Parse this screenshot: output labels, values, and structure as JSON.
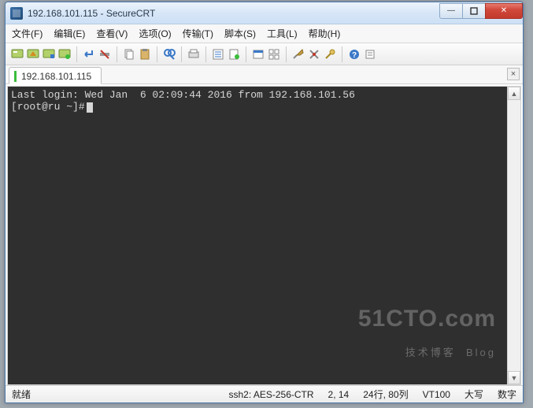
{
  "titlebar": {
    "title": "192.168.101.115 - SecureCRT"
  },
  "menu": {
    "file": "文件(F)",
    "edit": "编辑(E)",
    "view": "查看(V)",
    "options": "选项(O)",
    "transfer": "传输(T)",
    "script": "脚本(S)",
    "tools": "工具(L)",
    "help": "帮助(H)"
  },
  "tab": {
    "label": "192.168.101.115"
  },
  "terminal": {
    "line1": "Last login: Wed Jan  6 02:09:44 2016 from 192.168.101.56",
    "line2_prompt": "[root@ru ~]#"
  },
  "status": {
    "ready": "就绪",
    "cipher": "ssh2: AES-256-CTR",
    "pos": "2, 14",
    "dims": "24行, 80列",
    "mode1": "VT100",
    "mode2": "大写",
    "mode3": "数字"
  },
  "watermark": {
    "big": "51CTO.com",
    "small": "技术博客  Blog"
  },
  "icons": {
    "minimize": "—",
    "close": "✕",
    "up": "▲",
    "down": "▼",
    "tabclose": "×"
  }
}
